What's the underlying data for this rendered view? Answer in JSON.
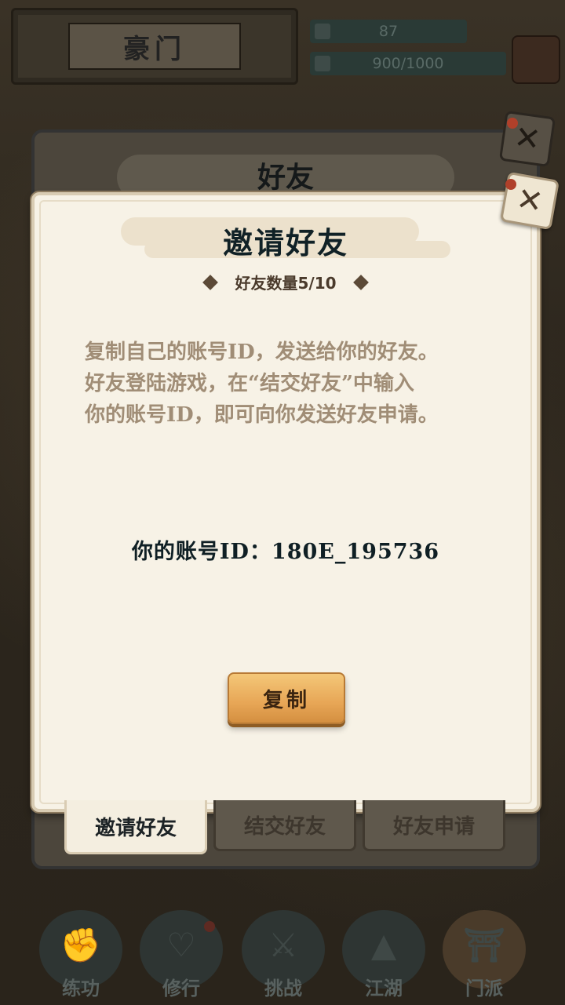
{
  "header": {
    "title": "豪门",
    "stat_primary": "87",
    "stat_energy": "900/1000"
  },
  "back_panel": {
    "title": "好友"
  },
  "dialog": {
    "title": "邀请好友",
    "friend_count": "好友数量5/10",
    "description_lines": [
      "复制自己的账号ID，发送给你的好友。",
      "好友登陆游戏，在“结交好友”中输入",
      "你的账号ID，即可向你发送好友申请。"
    ],
    "account_id": "你的账号ID：180E_195736",
    "copy_label": "复制"
  },
  "tabs": [
    {
      "label": "邀请好友",
      "active": true
    },
    {
      "label": "结交好友",
      "active": false
    },
    {
      "label": "好友申请",
      "active": false
    }
  ],
  "bottom_nav": [
    {
      "label": "练功",
      "icon": "fist-icon"
    },
    {
      "label": "修行",
      "icon": "heart-mind-icon"
    },
    {
      "label": "挑战",
      "icon": "crossed-swords-icon"
    },
    {
      "label": "江湖",
      "icon": "mountain-icon"
    },
    {
      "label": "门派",
      "icon": "gate-icon"
    }
  ],
  "colors": {
    "accent_button": "#e7a656",
    "dialog_bg": "#f7f2e6",
    "text_dark": "#0f1f24",
    "text_muted": "#a08d76"
  }
}
